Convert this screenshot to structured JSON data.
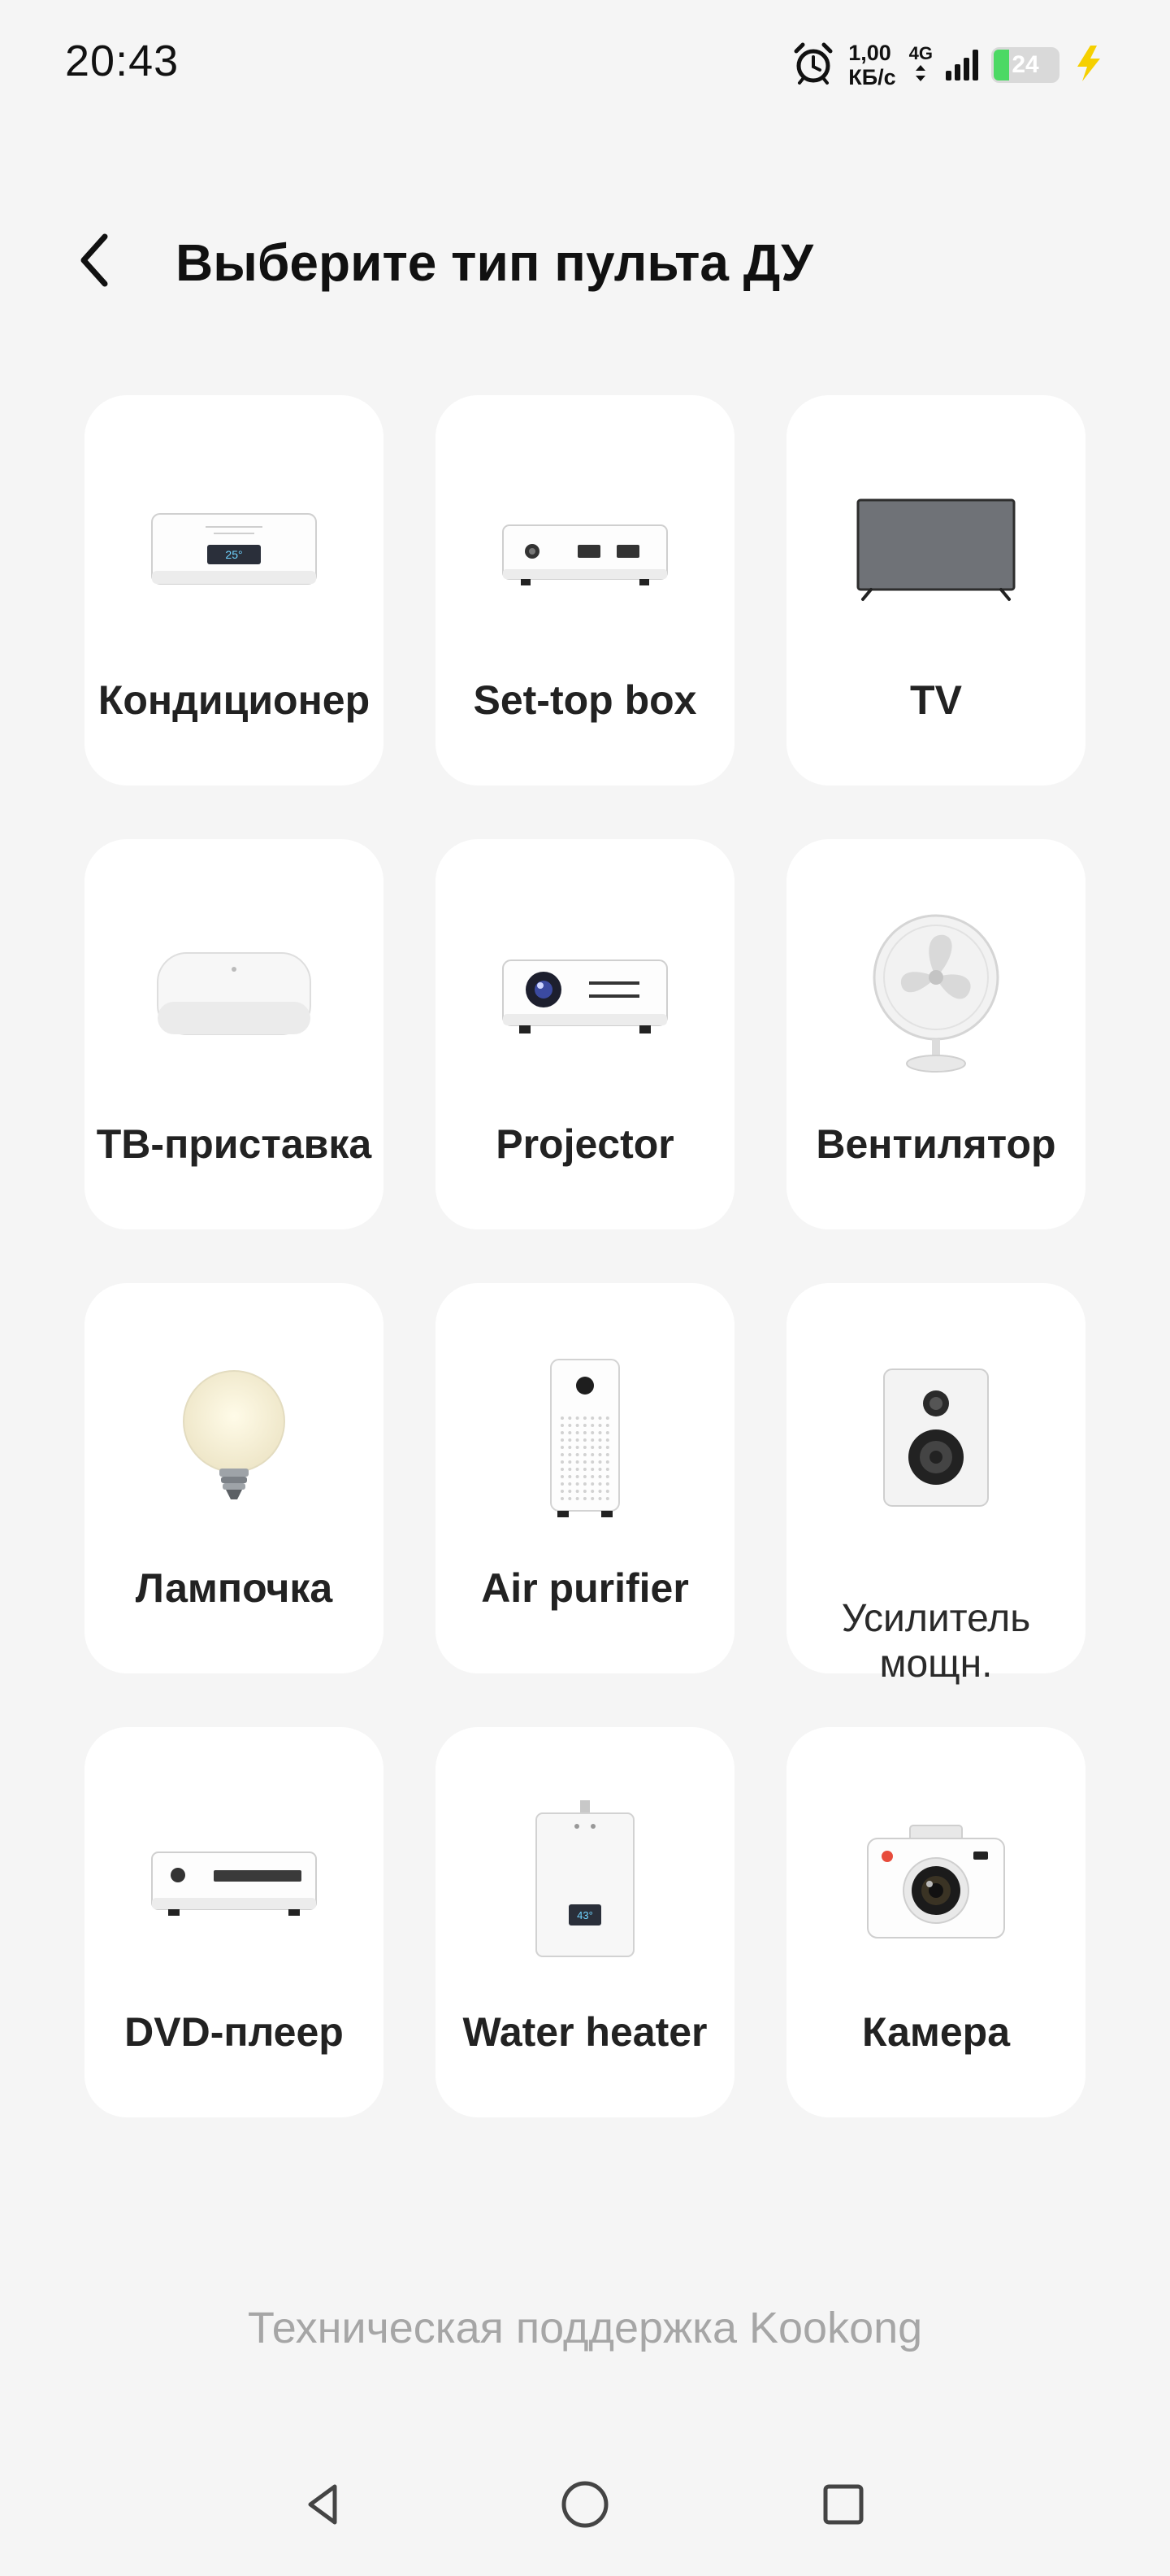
{
  "status_bar": {
    "time": "20:43",
    "speed_value": "1,00",
    "speed_unit": "КБ/с",
    "network_type": "4G",
    "battery_level": "24",
    "battery_percent": 24,
    "charging": true
  },
  "header": {
    "title": "Выберите тип пульта ДУ"
  },
  "devices": [
    {
      "label": "Кондиционер",
      "icon": "air-conditioner-icon"
    },
    {
      "label": "Set-top box",
      "icon": "set-top-box-icon"
    },
    {
      "label": "TV",
      "icon": "tv-icon"
    },
    {
      "label": "ТВ-приставка",
      "icon": "tv-box-icon"
    },
    {
      "label": "Projector",
      "icon": "projector-icon"
    },
    {
      "label": "Вентилятор",
      "icon": "fan-icon"
    },
    {
      "label": "Лампочка",
      "icon": "light-bulb-icon"
    },
    {
      "label": "Air purifier",
      "icon": "air-purifier-icon"
    },
    {
      "label": "Усилитель\nмощн.",
      "icon": "speaker-icon"
    },
    {
      "label": "DVD-плеер",
      "icon": "dvd-player-icon"
    },
    {
      "label": "Water heater",
      "icon": "water-heater-icon"
    },
    {
      "label": "Камера",
      "icon": "camera-icon"
    }
  ],
  "icon_texts": {
    "ac_temp": "25°",
    "heater_temp": "43°"
  },
  "footer": {
    "support_text": "Техническая поддержка Kookong"
  },
  "colors": {
    "background": "#f5f5f5",
    "card": "#ffffff",
    "battery_fill": "#4cd964",
    "charging_bolt": "#f5d000",
    "support_text": "#a6a6a6"
  }
}
